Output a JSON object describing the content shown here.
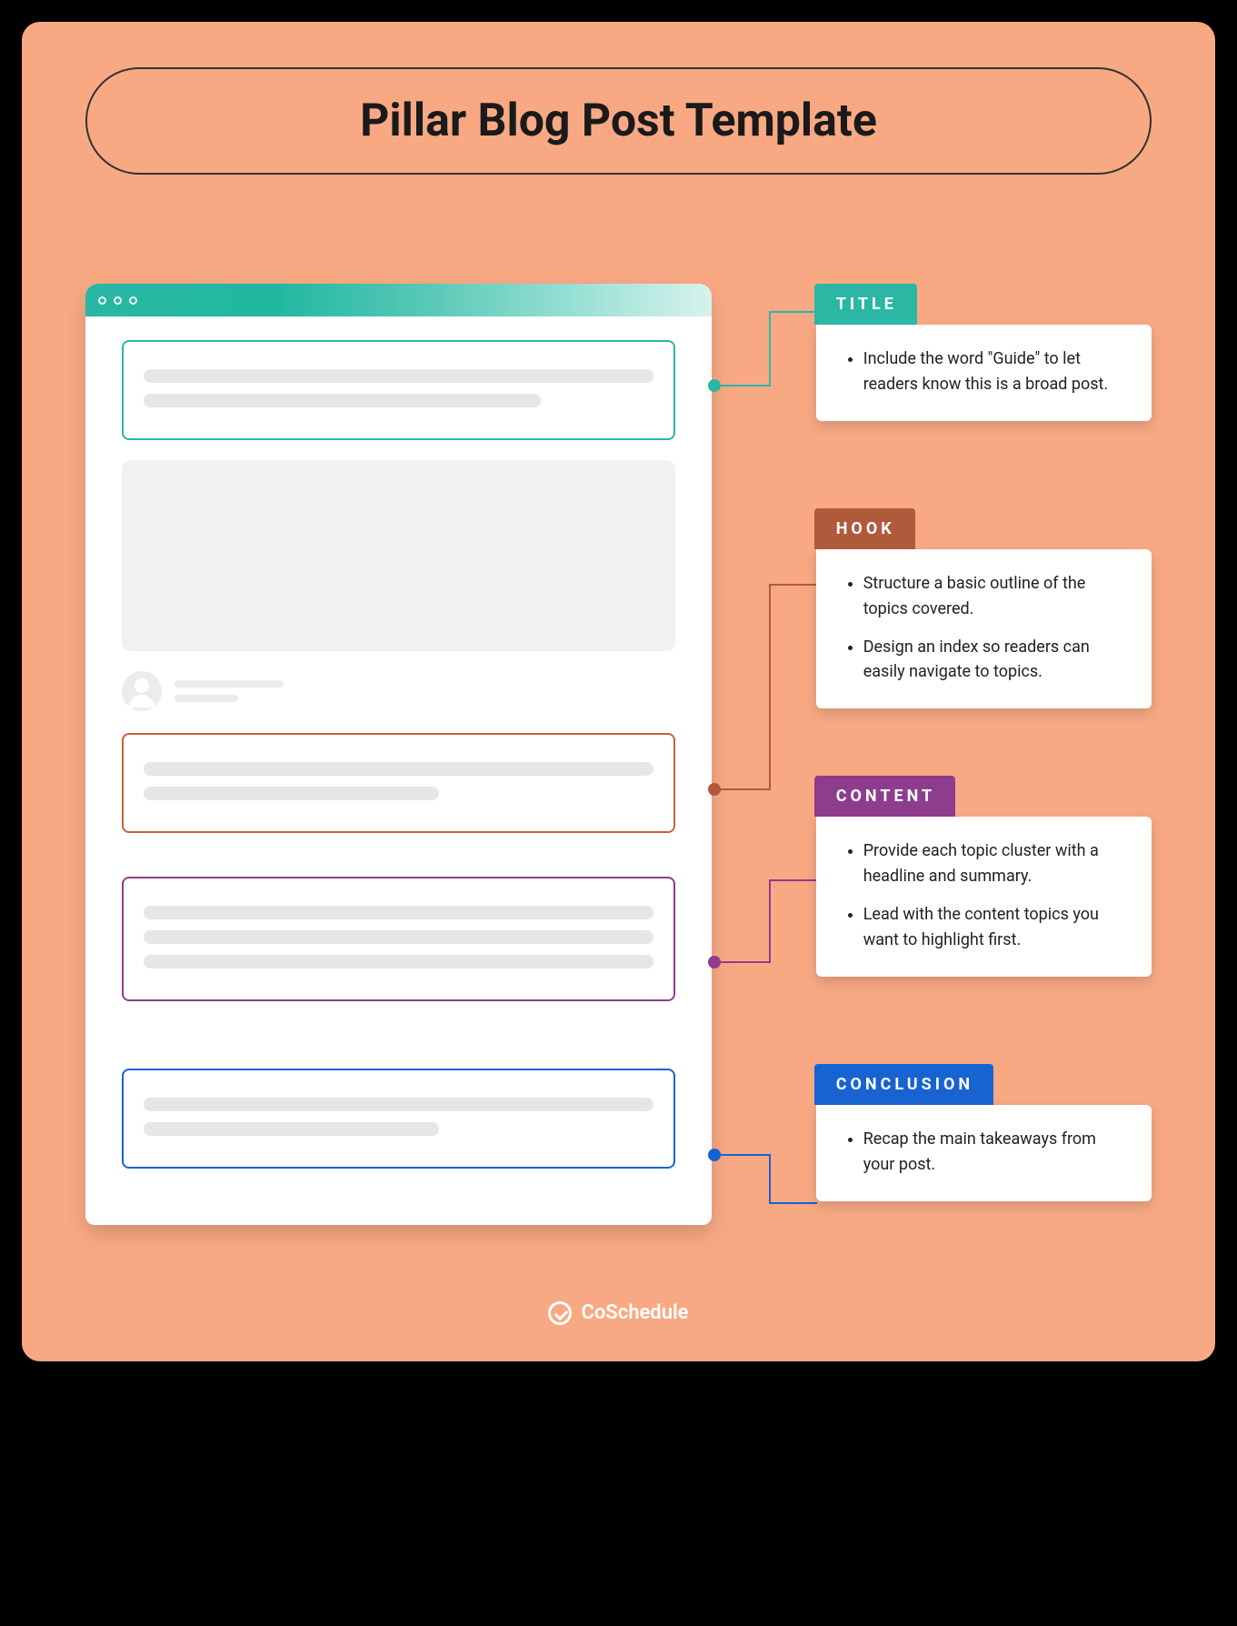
{
  "header": {
    "title": "Pillar Blog Post Template"
  },
  "sections": {
    "title": {
      "tag": "TITLE",
      "bullets": [
        "Include the word \"Guide\" to let readers know this is a broad post."
      ]
    },
    "hook": {
      "tag": "HOOK",
      "bullets": [
        "Structure a basic outline of the topics covered.",
        "Design an index so readers can easily navigate to topics."
      ]
    },
    "content": {
      "tag": "CONTENT",
      "bullets": [
        "Provide each topic cluster with a headline and summary.",
        "Lead with the content topics you want to highlight first."
      ]
    },
    "conclusion": {
      "tag": "CONCLUSION",
      "bullets": [
        "Recap the main takeaways from your post."
      ]
    }
  },
  "footer": {
    "brand": "CoSchedule"
  }
}
